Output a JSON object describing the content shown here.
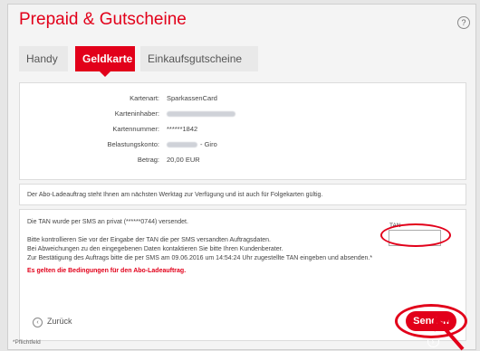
{
  "page": {
    "title": "Prepaid & Gutscheine",
    "help_label": "?"
  },
  "tabs": [
    {
      "label": "Handy",
      "active": false
    },
    {
      "label": "Geldkarte",
      "active": true
    },
    {
      "label": "Einkaufsgutscheine",
      "active": false
    }
  ],
  "summary": {
    "rows": [
      {
        "label": "Kartenart:",
        "value": "SparkassenCard"
      },
      {
        "label": "Karteninhaber:",
        "value": ""
      },
      {
        "label": "Kartennummer:",
        "value": "******1842"
      },
      {
        "label": "Belastungskonto:",
        "value": "- Giro"
      },
      {
        "label": "Betrag:",
        "value": "20,00 EUR"
      }
    ]
  },
  "info": {
    "text": "Der Abo-Ladeauftrag steht Ihnen am nächsten Werktag zur Verfügung und ist auch für Folgekarten gültig."
  },
  "tan": {
    "sent_text": "Die TAN wurde per SMS an privat (******0744) versendet.",
    "check_text": "Bitte kontrollieren Sie vor der Eingabe der TAN die per SMS versandten Auftragsdaten.",
    "deviation_text": "Bei Abweichungen zu den eingegebenen Daten kontaktieren Sie bitte Ihren Kundenberater.",
    "confirm_text": "Zur Bestätigung des Auftrags bitte die per SMS am 09.06.2016 um 14:54:24 Uhr zugestellte TAN eingeben und absenden.*",
    "terms_link": "Es gelten die Bedingungen für den Abo-Ladeauftrag.",
    "field_label": "TAN",
    "field_value": ""
  },
  "actions": {
    "back_label": "Zurück",
    "send_label": "Senden"
  },
  "footnote": "*Pflichtfeld",
  "colors": {
    "accent": "#e2001a",
    "background": "#f4f4f4"
  },
  "icons": {
    "help": "question-circle-icon",
    "back": "chevron-left-circle-icon",
    "send": "chevron-right-circle-icon"
  }
}
